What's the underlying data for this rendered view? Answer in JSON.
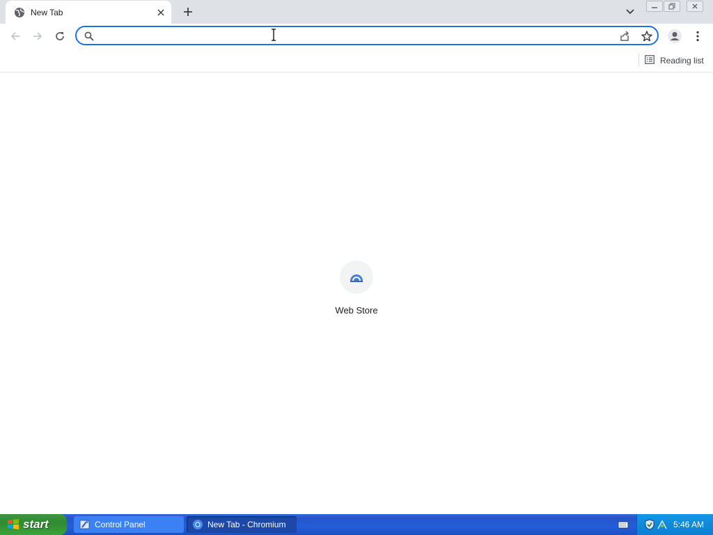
{
  "tab": {
    "title": "New Tab",
    "favicon": "globe-icon"
  },
  "toolbar": {
    "back": "arrow-left-icon",
    "forward": "arrow-right-icon",
    "reload": "reload-icon",
    "omnibox": {
      "value": "",
      "placeholder": ""
    },
    "menu": "three-dot-icon"
  },
  "bookmarks": {
    "reading_list_label": "Reading list"
  },
  "ntp": {
    "shortcuts": [
      {
        "label": "Web Store"
      }
    ]
  },
  "taskbar": {
    "start_label": "start",
    "tasks": [
      {
        "label": "Control Panel"
      },
      {
        "label": "New Tab - Chromium"
      }
    ],
    "clock": "5:46 AM"
  },
  "colors": {
    "tab_strip": "#dee1e6",
    "omnibox_focus": "#1a73e8",
    "taskbar": "#245edb",
    "start_button": "#3aa43a"
  }
}
